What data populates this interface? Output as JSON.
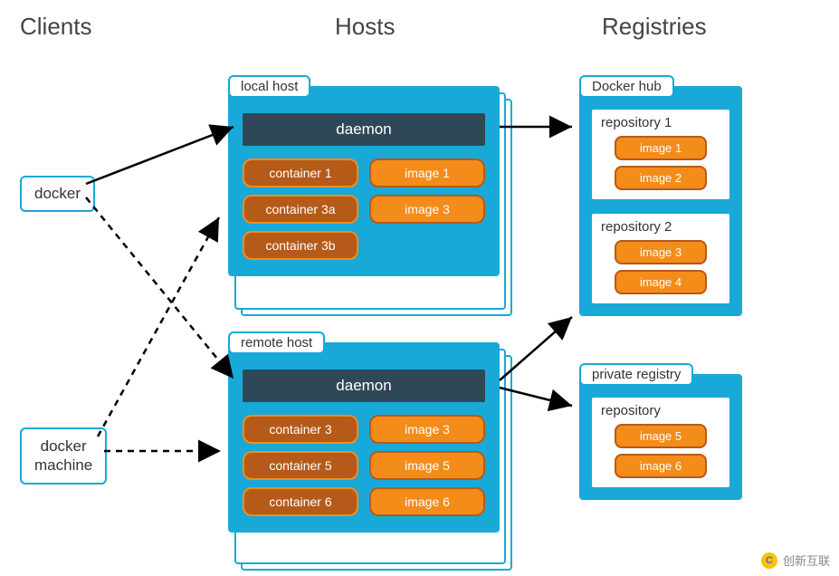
{
  "columns": {
    "clients": "Clients",
    "hosts": "Hosts",
    "registries": "Registries"
  },
  "clients": {
    "docker": "docker",
    "machine": "docker\nmachine"
  },
  "hosts": {
    "local": {
      "label": "local host",
      "daemon": "daemon",
      "rows": [
        [
          "container 1",
          "image 1"
        ],
        [
          "container 3a",
          "image 3"
        ],
        [
          "container 3b",
          null
        ]
      ]
    },
    "remote": {
      "label": "remote host",
      "daemon": "daemon",
      "rows": [
        [
          "container 3",
          "image 3"
        ],
        [
          "container 5",
          "image 5"
        ],
        [
          "container 6",
          "image 6"
        ]
      ]
    }
  },
  "registries": {
    "hub": {
      "label": "Docker hub",
      "repos": [
        {
          "title": "repository 1",
          "images": [
            "image 1",
            "image 2"
          ]
        },
        {
          "title": "repository 2",
          "images": [
            "image 3",
            "image 4"
          ]
        }
      ]
    },
    "private": {
      "label": "private registry",
      "repos": [
        {
          "title": "repository",
          "images": [
            "image 5",
            "image 6"
          ]
        }
      ]
    }
  },
  "watermark": "创新互联"
}
